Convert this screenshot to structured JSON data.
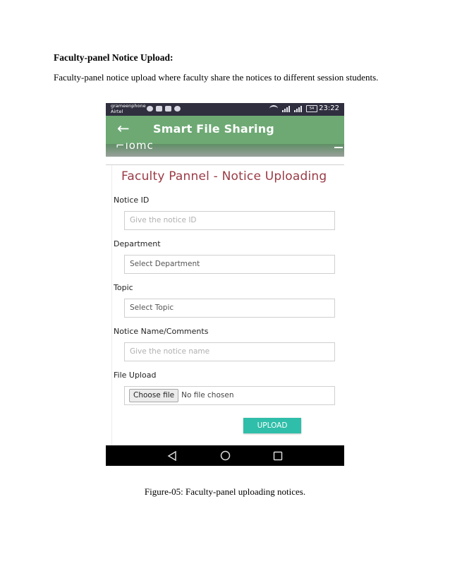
{
  "document": {
    "heading": "Faculty-panel Notice Upload:",
    "paragraph": "Faculty-panel notice upload where faculty share the notices to different session students.",
    "caption": "Figure-05: Faculty-panel uploading notices."
  },
  "status_bar": {
    "carrier_1": "grameenphone",
    "carrier_2": "Airtel",
    "battery": "54",
    "time": "23:22",
    "icons": [
      "messenger-icon",
      "mail-icon",
      "gallery-icon",
      "chat-icon",
      "wifi-icon",
      "signal-icon",
      "signal-icon",
      "battery-icon"
    ]
  },
  "app_bar": {
    "back_icon": "arrow-left-icon",
    "title": "Smart File Sharing"
  },
  "panel": {
    "title": "Faculty Pannel - Notice Uploading",
    "fields": {
      "notice_id": {
        "label": "Notice ID",
        "placeholder": "Give the notice ID"
      },
      "department": {
        "label": "Department",
        "value": "Select Department"
      },
      "topic": {
        "label": "Topic",
        "value": "Select Topic"
      },
      "notice_name": {
        "label": "Notice Name/Comments",
        "placeholder": "Give the notice name"
      },
      "file_upload": {
        "label": "File Upload",
        "button": "Choose file",
        "status": "No file chosen"
      }
    },
    "upload_label": "UPLOAD"
  },
  "colors": {
    "app_bar": "#6ea974",
    "panel_title": "#9a3a45",
    "upload_button": "#2fbea9",
    "status_bar": "#2f2f3f"
  },
  "nav_bar": {
    "icons": [
      "back-triangle-icon",
      "home-circle-icon",
      "recents-square-icon"
    ]
  }
}
